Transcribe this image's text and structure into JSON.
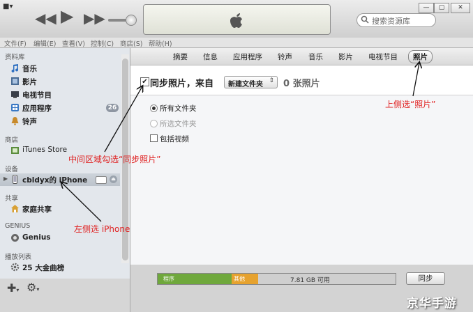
{
  "toolbar": {
    "search_placeholder": "搜索资源库",
    "win_minimize": "—",
    "win_restore": "▢",
    "win_close": "✕"
  },
  "menu": [
    "文件(F)",
    "编辑(E)",
    "查看(V)",
    "控制(C)",
    "商店(S)",
    "帮助(H)"
  ],
  "sidebar": {
    "library_header": "资料库",
    "library": [
      {
        "label": "音乐",
        "icon": "music-note-icon"
      },
      {
        "label": "影片",
        "icon": "film-icon"
      },
      {
        "label": "电视节目",
        "icon": "tv-icon"
      },
      {
        "label": "应用程序",
        "icon": "apps-icon",
        "badge": "26"
      },
      {
        "label": "铃声",
        "icon": "bell-icon"
      }
    ],
    "store_header": "商店",
    "store": [
      {
        "label": "iTunes Store",
        "icon": "store-icon"
      }
    ],
    "devices_header": "设备",
    "device": {
      "label": "cbldyx的 iPhone",
      "icon": "iphone-icon"
    },
    "shared_header": "共享",
    "shared": [
      {
        "label": "家庭共享",
        "icon": "home-icon"
      }
    ],
    "genius_header": "GENIUS",
    "genius": [
      {
        "label": "Genius",
        "icon": "genius-icon"
      }
    ],
    "playlists_header": "播放列表",
    "playlists": [
      {
        "label": "25 大金曲榜",
        "icon": "gear-playlist-icon"
      }
    ]
  },
  "tabs": [
    "摘要",
    "信息",
    "应用程序",
    "铃声",
    "音乐",
    "影片",
    "电视节目",
    "照片"
  ],
  "active_tab": "照片",
  "sync": {
    "label": "同步照片，来自",
    "source": "新建文件夹",
    "count": "0 张照片",
    "options": {
      "all_folders": "所有文件夹",
      "selected_folders": "所选文件夹",
      "include_videos": "包括视频"
    }
  },
  "capacity": {
    "segments": [
      {
        "label": "程序",
        "color": "#6fa83c"
      },
      {
        "label": "其他",
        "color": "#e6a22e"
      }
    ],
    "free_text": "7.81 GB 可用"
  },
  "sync_button": "同步",
  "annotations": {
    "top_right": "上侧选“照片”",
    "middle": "中间区域勾选“同步照片”",
    "left": "左侧选 iPhone"
  },
  "watermark": "京华手游"
}
